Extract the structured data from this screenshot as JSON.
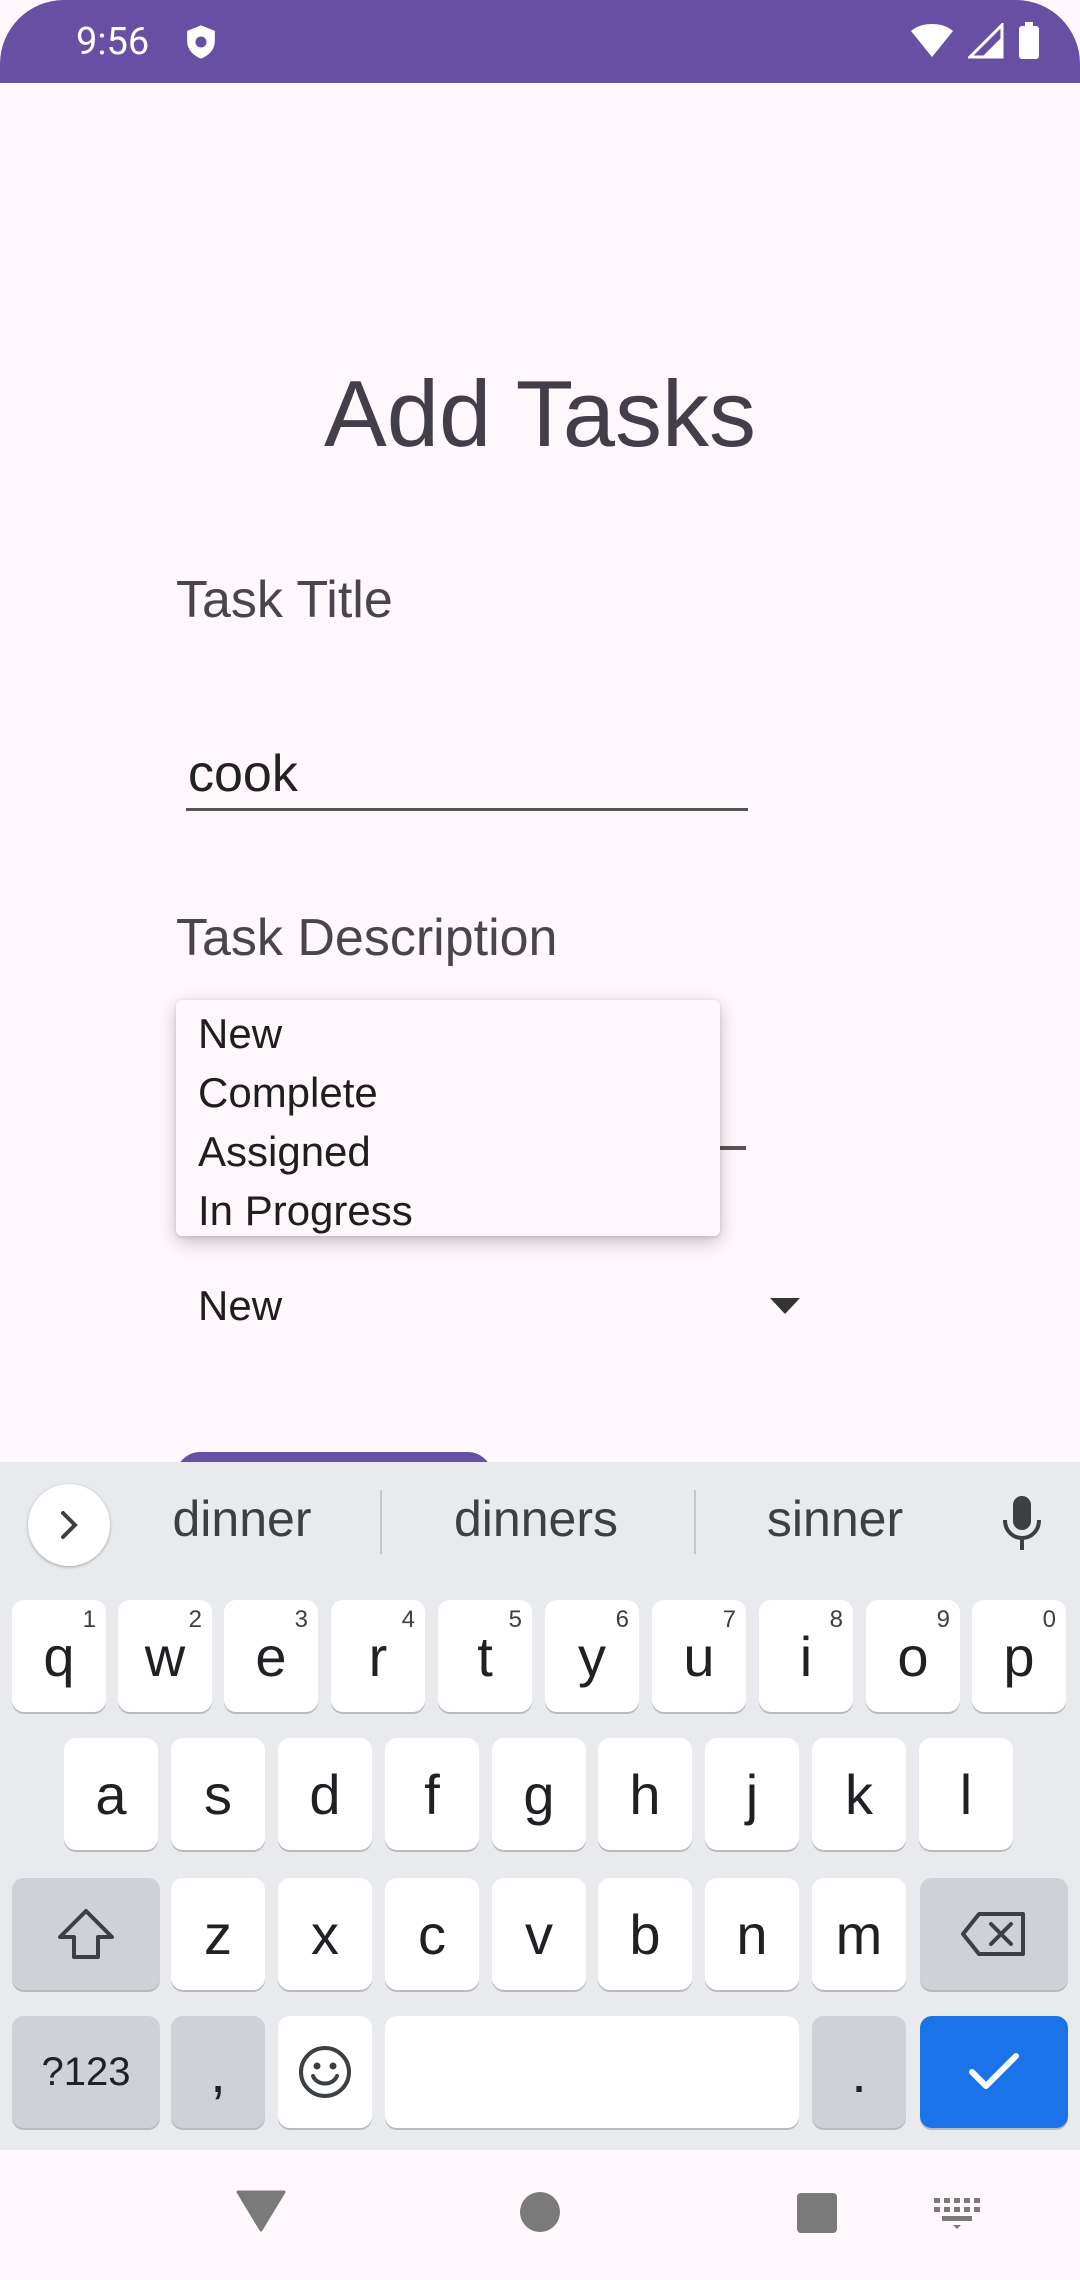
{
  "status": {
    "time": "9:56"
  },
  "page": {
    "title": "Add Tasks"
  },
  "form": {
    "title_label": "Task Title",
    "title_value": "cook",
    "description_label": "Task Description",
    "status_selected": "New"
  },
  "status_dropdown": {
    "options": [
      "New",
      "Complete",
      "Assigned",
      "In Progress"
    ]
  },
  "keyboard": {
    "suggestions": [
      "dinner",
      "dinners",
      "sinner"
    ],
    "row1": [
      {
        "key": "q",
        "hint": "1"
      },
      {
        "key": "w",
        "hint": "2"
      },
      {
        "key": "e",
        "hint": "3"
      },
      {
        "key": "r",
        "hint": "4"
      },
      {
        "key": "t",
        "hint": "5"
      },
      {
        "key": "y",
        "hint": "6"
      },
      {
        "key": "u",
        "hint": "7"
      },
      {
        "key": "i",
        "hint": "8"
      },
      {
        "key": "o",
        "hint": "9"
      },
      {
        "key": "p",
        "hint": "0"
      }
    ],
    "row2": [
      "a",
      "s",
      "d",
      "f",
      "g",
      "h",
      "j",
      "k",
      "l"
    ],
    "row3": [
      "z",
      "x",
      "c",
      "v",
      "b",
      "n",
      "m"
    ],
    "symbols_label": "?123",
    "comma_label": ",",
    "period_label": "."
  }
}
